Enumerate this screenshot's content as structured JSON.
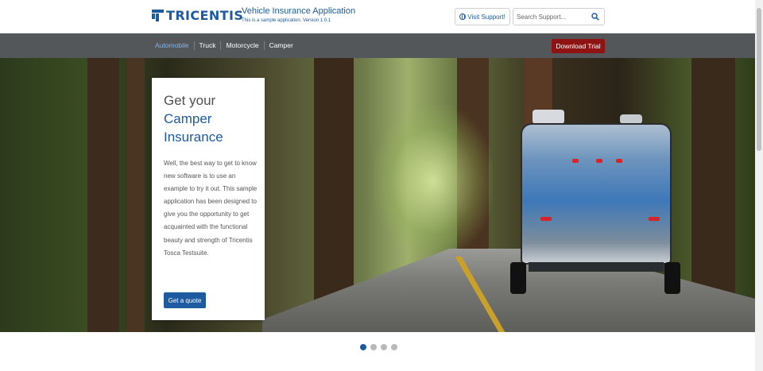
{
  "header": {
    "logo_text": "TRICENTIS",
    "app_title": "Vehicle Insurance Application",
    "app_subtitle": "This is a sample application. Version 1.0.1",
    "support_label": "Visit Support!",
    "search_placeholder": "Search Support..."
  },
  "nav": {
    "items": [
      {
        "label": "Automobile",
        "active": true
      },
      {
        "label": "Truck",
        "active": false
      },
      {
        "label": "Motorcycle",
        "active": false
      },
      {
        "label": "Camper",
        "active": false
      }
    ],
    "download_label": "Download Trial"
  },
  "hero": {
    "heading_line1": "Get your",
    "heading_line2": "Camper Insurance",
    "body": "Well, the best way to get to know new software is to use an example to try it out. This sample application has been designed to give you the opportunity to get acquainted with the functional beauty and strength of Tricentis Tosca Testsuite.",
    "button_label": "Get a quote"
  },
  "carousel": {
    "slide_count": 4,
    "active_index": 0
  },
  "colors": {
    "brand_blue": "#1e5aa0",
    "nav_bg": "#54575a",
    "download_red": "#8f1313",
    "nav_active": "#7fb3ea"
  },
  "icons": {
    "support": "globe-icon",
    "search": "search-icon"
  }
}
